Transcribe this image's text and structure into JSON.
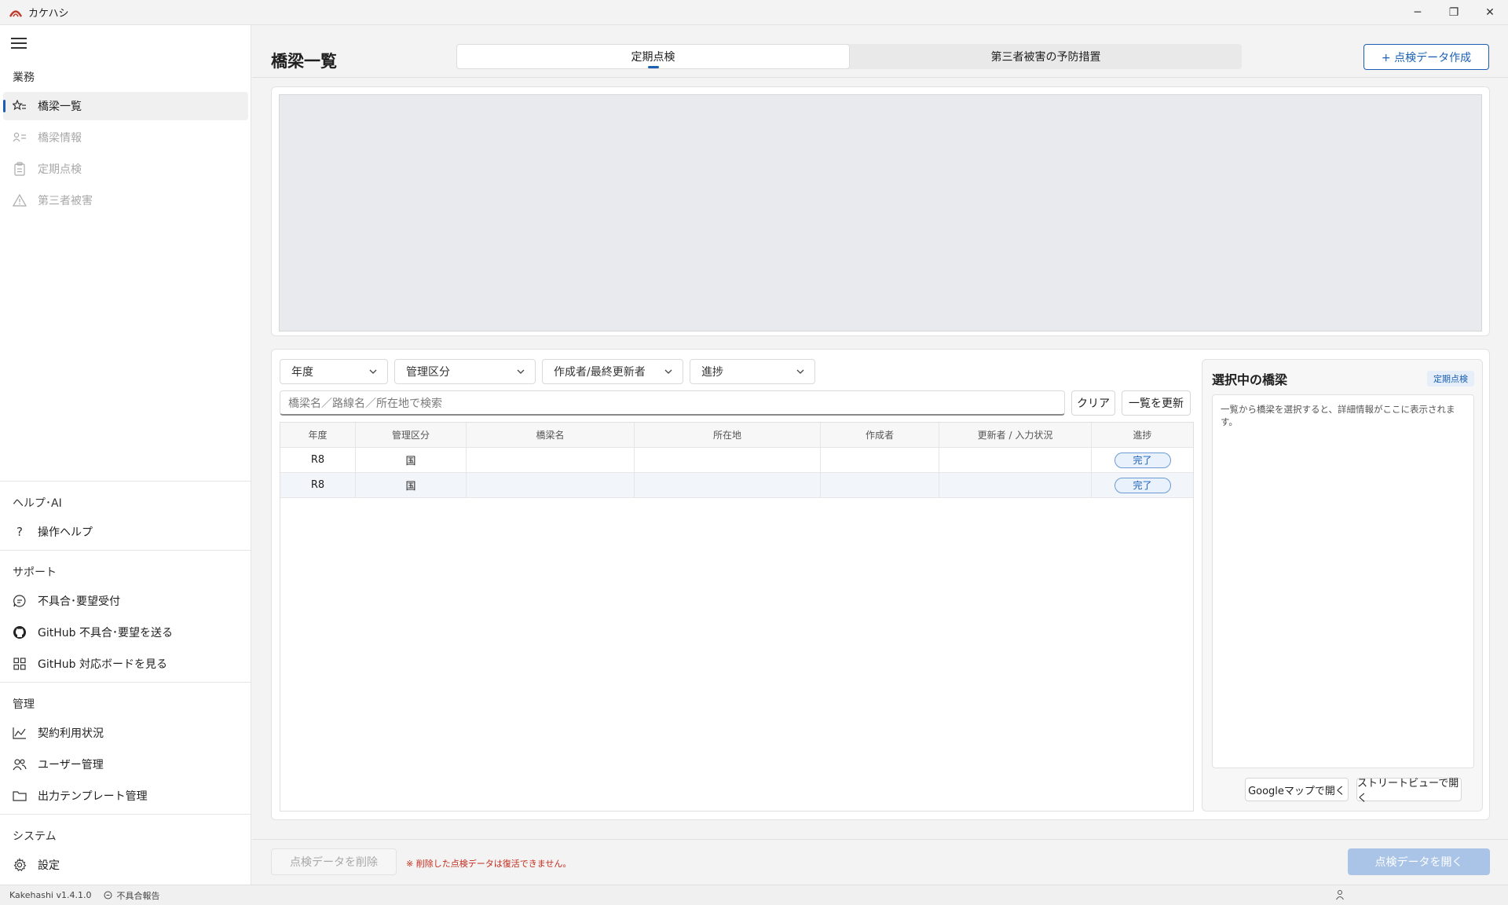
{
  "app": {
    "title": "カケハシ"
  },
  "window_controls": {
    "minimize": "─",
    "maximize": "❐",
    "close": "✕"
  },
  "sidebar": {
    "section_work": "業務",
    "work_items": [
      {
        "label": "橋梁一覧",
        "icon": "star-list-icon"
      },
      {
        "label": "橋梁情報",
        "icon": "person-list-icon"
      },
      {
        "label": "定期点検",
        "icon": "clipboard-icon"
      },
      {
        "label": "第三者被害",
        "icon": "warning-icon"
      }
    ],
    "section_help": "ヘルプ･AI",
    "help_items": [
      {
        "label": "操作ヘルプ",
        "icon": "question-icon"
      }
    ],
    "section_support": "サポート",
    "support_items": [
      {
        "label": "不具合･要望受付",
        "icon": "chat-icon"
      },
      {
        "label": "GitHub 不具合･要望を送る",
        "icon": "github-icon"
      },
      {
        "label": "GitHub 対応ボードを見る",
        "icon": "board-icon"
      }
    ],
    "section_admin": "管理",
    "admin_items": [
      {
        "label": "契約利用状況",
        "icon": "chart-icon"
      },
      {
        "label": "ユーザー管理",
        "icon": "users-icon"
      },
      {
        "label": "出力テンプレート管理",
        "icon": "folder-icon"
      }
    ],
    "section_system": "システム",
    "system_items": [
      {
        "label": "設定",
        "icon": "gear-icon"
      }
    ]
  },
  "header": {
    "title": "橋梁一覧",
    "tabs": [
      {
        "label": "定期点検",
        "active": true
      },
      {
        "label": "第三者被害の予防措置",
        "active": false
      }
    ],
    "create_button": "+ 点検データ作成"
  },
  "filters": {
    "year": "年度",
    "mgmt": "管理区分",
    "author": "作成者/最終更新者",
    "progress": "進捗",
    "search_placeholder": "橋梁名／路線名／所在地で検索",
    "clear": "クリア",
    "refresh": "一覧を更新"
  },
  "table": {
    "columns": [
      "年度",
      "管理区分",
      "橋梁名",
      "所在地",
      "作成者",
      "更新者 / 入力状況",
      "進捗"
    ],
    "rows": [
      {
        "year": "R8",
        "mgmt": "国",
        "name": "",
        "location": "",
        "author": "",
        "updater": "",
        "progress": "完了"
      },
      {
        "year": "R8",
        "mgmt": "国",
        "name": "",
        "location": "",
        "author": "",
        "updater": "",
        "progress": "完了"
      }
    ]
  },
  "detail": {
    "title": "選択中の橋梁",
    "badge": "定期点検",
    "hint": "一覧から橋梁を選択すると、詳細情報がここに表示されます。",
    "google_maps": "Googleマップで開く",
    "street_view": "ストリートビューで開く"
  },
  "footer": {
    "delete": "点検データを削除",
    "warning": "※ 削除した点検データは復活できません。",
    "open": "点検データを開く"
  },
  "status": {
    "version": "Kakehashi v1.4.1.0",
    "bug_report": "不具合報告"
  },
  "colors": {
    "accent": "#1a5fb4",
    "warning": "#c42b1c",
    "logo": "#c0392b"
  }
}
